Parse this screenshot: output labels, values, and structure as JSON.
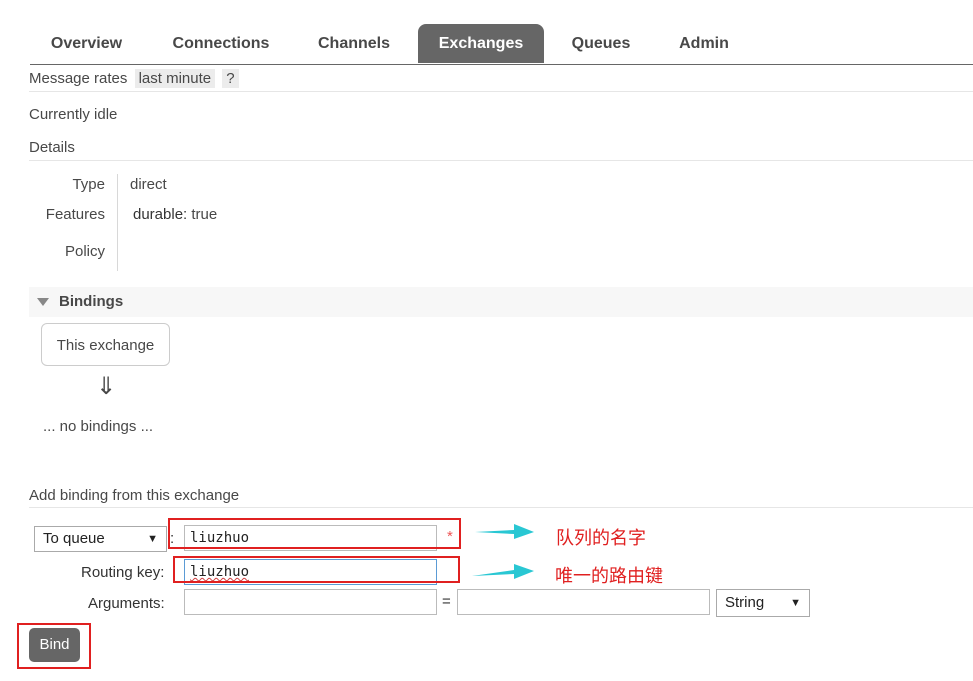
{
  "tabs": [
    {
      "label": "Overview"
    },
    {
      "label": "Connections"
    },
    {
      "label": "Channels"
    },
    {
      "label": "Exchanges",
      "active": true
    },
    {
      "label": "Queues"
    },
    {
      "label": "Admin"
    }
  ],
  "message_rates": {
    "label": "Message rates",
    "period": "last minute",
    "help": "?"
  },
  "status": "Currently idle",
  "details": {
    "title": "Details",
    "type_label": "Type",
    "type_value": "direct",
    "features_label": "Features",
    "features_key": "durable:",
    "features_value": "true",
    "policy_label": "Policy"
  },
  "bindings": {
    "title": "Bindings",
    "this_exchange": "This exchange",
    "arrow": "⇓",
    "empty": "... no bindings ..."
  },
  "add_binding": {
    "title": "Add binding from this exchange",
    "destination_type": "To queue",
    "destination_colon": ":",
    "destination_value": "liuzhuo",
    "required_mark": "*",
    "routing_key_label": "Routing key:",
    "routing_key_value": "liuzhuo",
    "arguments_label": "Arguments:",
    "arguments_eq": "=",
    "arguments_type": "String",
    "bind_button": "Bind"
  },
  "annotations": {
    "queue_name": "队列的名字",
    "routing_key": "唯一的路由键"
  },
  "colors": {
    "accent": "#666666",
    "annotation_red": "#e02020",
    "annotation_arrow": "#29c7d3"
  }
}
